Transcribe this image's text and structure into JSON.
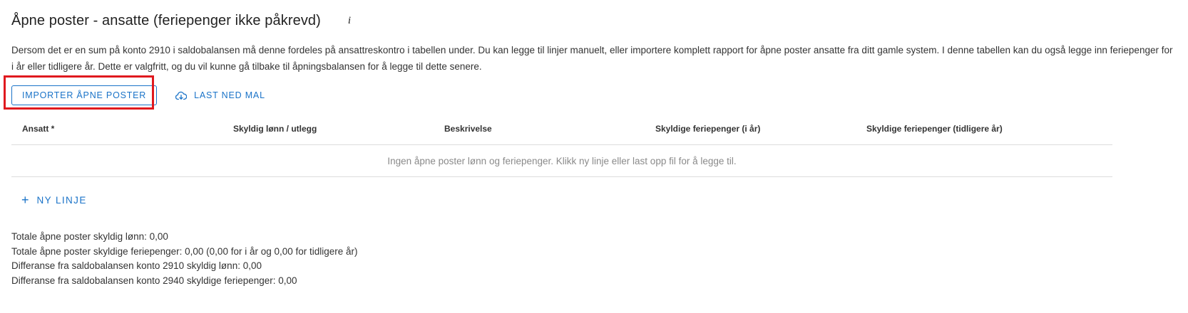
{
  "header": {
    "title": "Åpne poster - ansatte (feriepenger ikke påkrevd)",
    "info_icon_glyph": "i"
  },
  "description": "Dersom det er en sum på konto 2910 i saldobalansen må denne fordeles på ansattreskontro i tabellen under. Du kan legge til linjer manuelt, eller importere komplett rapport for åpne poster ansatte fra ditt gamle system. I denne tabellen kan du også legge inn feriepenger for i år eller tidligere år. Dette er valgfritt, og du vil kunne gå tilbake til åpningsbalansen for å legge til dette senere.",
  "actions": {
    "import_label": "IMPORTER ÅPNE POSTER",
    "download_label": "LAST NED MAL",
    "download_icon": "cloud-download-icon"
  },
  "table": {
    "columns": [
      "Ansatt *",
      "Skyldig lønn / utlegg",
      "Beskrivelse",
      "Skyldige feriepenger (i år)",
      "Skyldige feriepenger (tidligere år)"
    ],
    "empty_text": "Ingen åpne poster lønn og feriepenger. Klikk ny linje eller last opp fil for å legge til."
  },
  "add_line": {
    "icon": "+",
    "label": "NY LINJE"
  },
  "totals": [
    "Totale åpne poster skyldig lønn: 0,00",
    "Totale åpne poster skyldige feriepenger: 0,00 (0,00 for i år og 0,00 for tidligere år)",
    "Differanse fra saldobalansen konto 2910 skyldig lønn: 0,00",
    "Differanse fra saldobalansen konto 2940 skyldige feriepenger: 0,00"
  ],
  "colors": {
    "accent": "#1a73c8",
    "highlight": "#e0191e",
    "muted_text": "#8a8a8a",
    "divider": "#dcdcdc"
  }
}
